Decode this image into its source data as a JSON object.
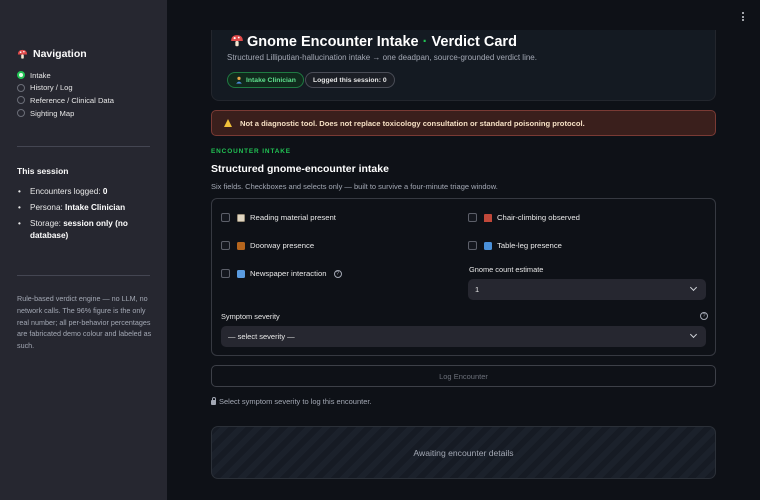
{
  "sidebar": {
    "nav_title": "Navigation",
    "nav_items": [
      "Intake",
      "History / Log",
      "Reference / Clinical Data",
      "Sighting Map"
    ],
    "selected_nav": "Intake",
    "session_title": "This session",
    "session_items": [
      {
        "label": "Encounters logged: ",
        "value": "0"
      },
      {
        "label": "Persona: ",
        "value": "Intake Clinician"
      },
      {
        "label": "Storage: ",
        "value": "session only (no database)"
      }
    ],
    "footnote": "Rule-based verdict engine — no LLM, no network calls. The 96% figure is the only real number; all per-behavior percentages are fabricated demo colour and labeled as such."
  },
  "hero": {
    "title_main": "Gnome Encounter Intake",
    "title_sep": " · ",
    "title_end": "Verdict Card",
    "subtitle": "Structured Lilliputian-hallucination intake → one deadpan, source-grounded verdict line.",
    "chip_persona": "Intake Clinician",
    "chip_logged": "Logged this session: 0"
  },
  "warning": "Not a diagnostic tool. Does not replace toxicology consultation or standard poisoning protocol.",
  "section": {
    "label": "ENCOUNTER INTAKE",
    "title": "Structured gnome-encounter intake",
    "subtitle": "Six fields. Checkboxes and selects only — built to survive a four-minute triage window."
  },
  "form": {
    "checkboxes": {
      "reading": "Reading material present",
      "doorway": "Doorway presence",
      "newspaper": "Newspaper interaction",
      "chair": "Chair-climbing observed",
      "tableleg": "Table-leg presence"
    },
    "gnome_count_label": "Gnome count estimate",
    "gnome_count_value": "1",
    "severity_label": "Symptom severity",
    "severity_value": "— select severity —"
  },
  "log_button": "Log Encounter",
  "lock_note": "Select symptom severity to log this encounter.",
  "await_text": "Awaiting encounter details",
  "colors": {
    "accent_green": "#21c354",
    "warning_bg": "#3a1f1c",
    "sidebar_bg": "#262730",
    "page_bg": "#0e1117"
  }
}
